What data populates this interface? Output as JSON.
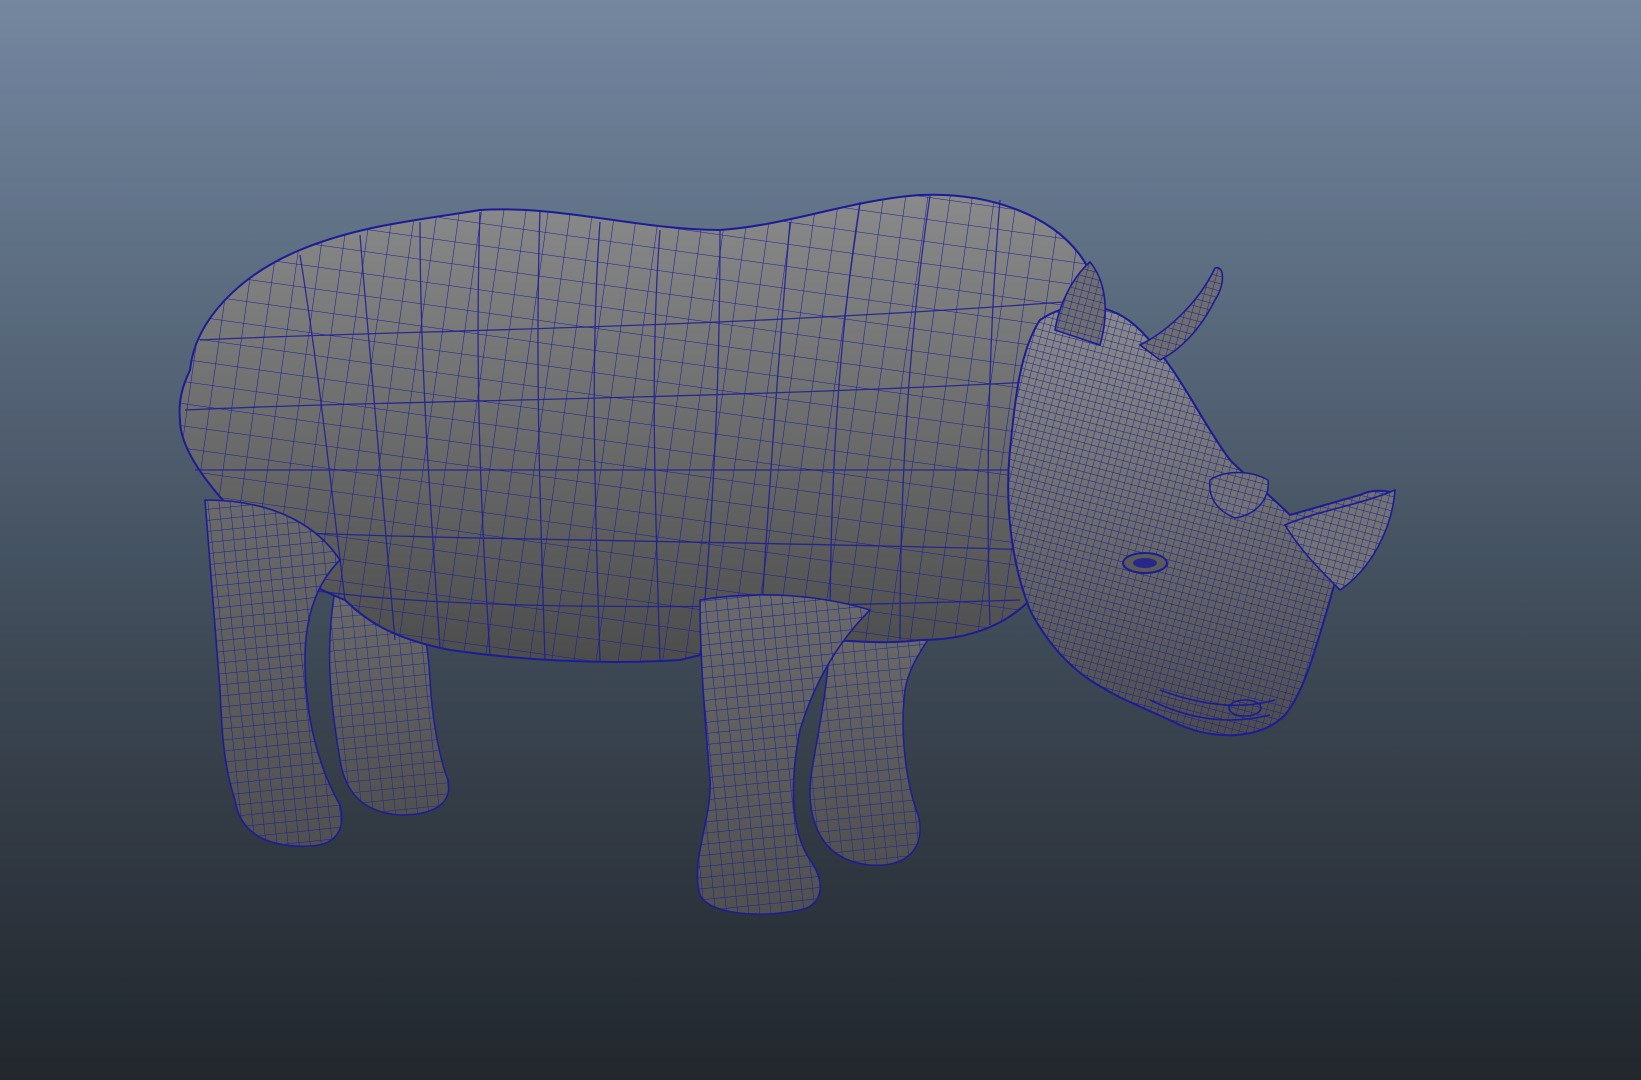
{
  "viewport": {
    "background_top": "#74879f",
    "background_bottom": "#22272d"
  },
  "model": {
    "name": "rhino-mesh",
    "shading": "smooth-shaded-with-wireframe",
    "surface_color": "#6f6f6f",
    "wireframe_color": "#1a1a8c"
  }
}
